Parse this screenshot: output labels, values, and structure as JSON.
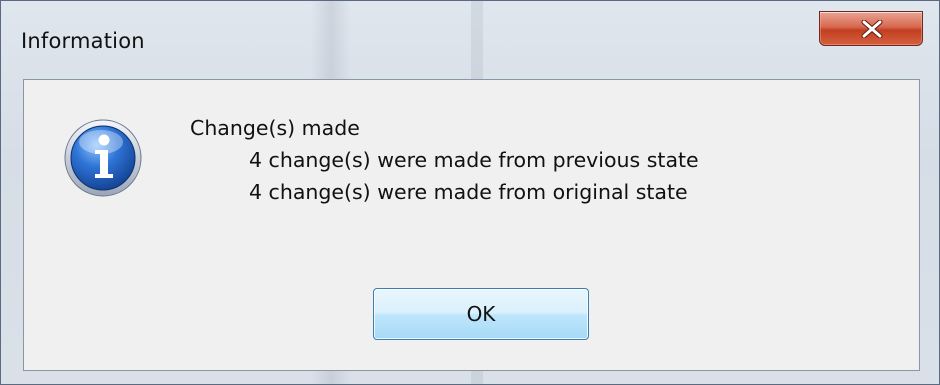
{
  "dialog": {
    "title": "Information",
    "icon": "information-icon",
    "close_icon": "close-icon",
    "message": {
      "heading": "Change(s) made",
      "lines": [
        "4 change(s) were made from previous state",
        "4 change(s) were made from original state"
      ]
    },
    "ok_label": "OK"
  },
  "colors": {
    "close_button": "#c8452a",
    "ok_button_border": "#3c7fb1",
    "client_background": "#f0f0f0",
    "info_icon_blue": "#2d6fcf"
  }
}
